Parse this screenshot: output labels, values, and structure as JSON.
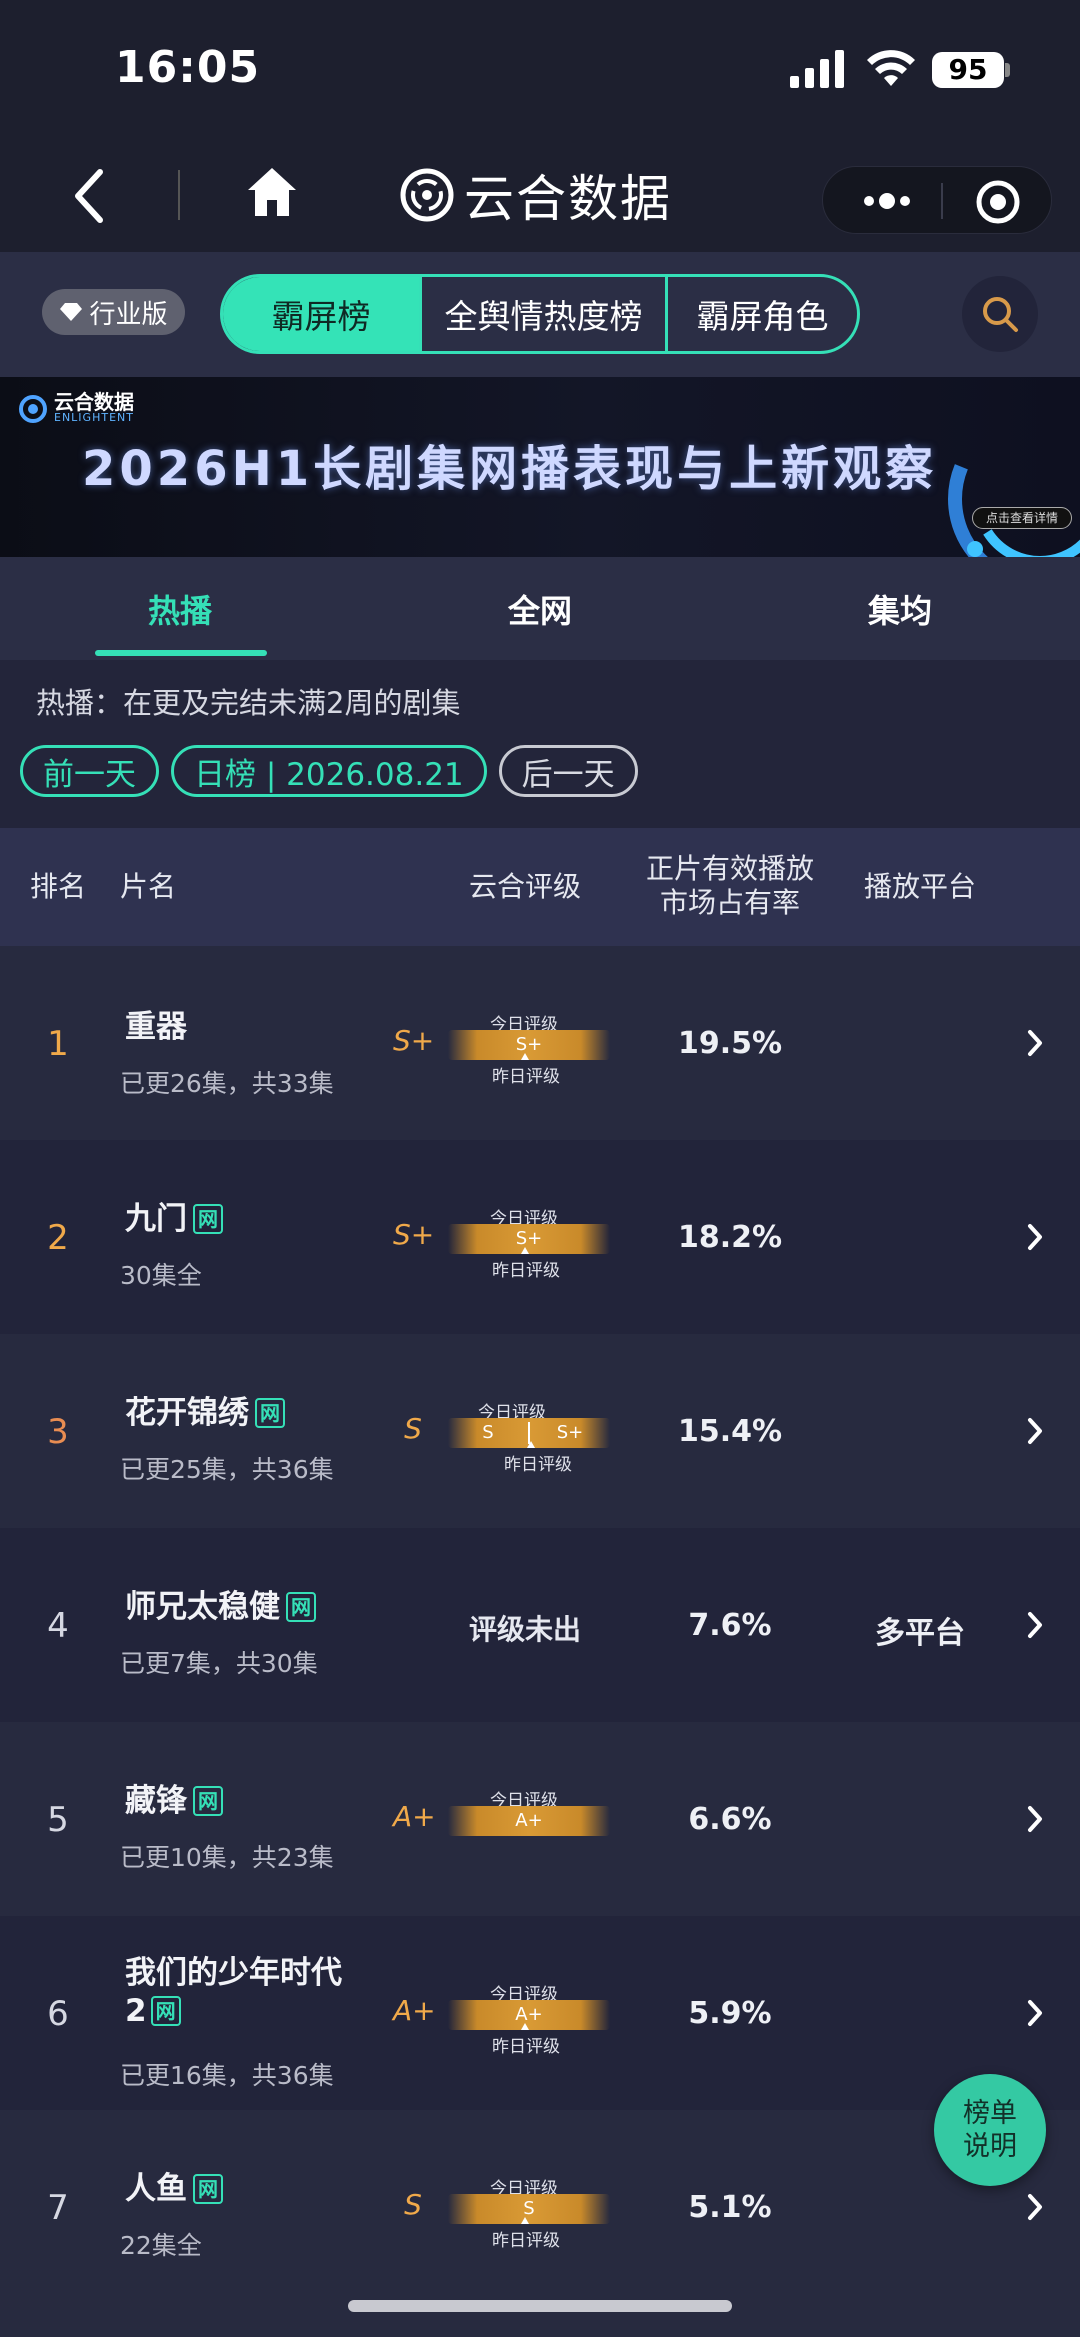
{
  "status": {
    "time": "16:05",
    "battery": "95"
  },
  "nav": {
    "title": "云合数据"
  },
  "toolbar": {
    "edition": "行业版",
    "tabs": [
      "霸屏榜",
      "全舆情热度榜",
      "霸屏角色"
    ]
  },
  "banner": {
    "brand_cn": "云合数据",
    "brand_en": "ENLIGHTENT",
    "title": "2026H1长剧集网播表现与上新观察",
    "cta": "点击查看详情"
  },
  "subtabs": [
    "热播",
    "全网",
    "集均"
  ],
  "description": "热播：在更及完结未满2周的剧集",
  "datebar": {
    "prev": "前一天",
    "current": "日榜 | 2026.08.21",
    "next": "后一天"
  },
  "table": {
    "headers": {
      "rank": "排名",
      "title": "片名",
      "grade": "云合评级",
      "share_line1": "正片有效播放",
      "share_line2": "市场占有率",
      "platform": "播放平台"
    },
    "grade_today_label": "今日评级",
    "grade_yesterday_label": "昨日评级",
    "rows": [
      {
        "rank": "1",
        "title": "重器",
        "title_line2": "",
        "web": false,
        "episodes": "已更26集，共33集",
        "grade": "S+",
        "bar": "S+",
        "bar_prev": "",
        "share": "19.5%",
        "platform": "",
        "no_grade": ""
      },
      {
        "rank": "2",
        "title": "九门",
        "title_line2": "",
        "web": true,
        "episodes": "30集全",
        "grade": "S+",
        "bar": "S+",
        "bar_prev": "",
        "share": "18.2%",
        "platform": "",
        "no_grade": ""
      },
      {
        "rank": "3",
        "title": "花开锦绣",
        "title_line2": "",
        "web": true,
        "episodes": "已更25集，共36集",
        "grade": "S",
        "bar": "S+",
        "bar_prev": "S",
        "share": "15.4%",
        "platform": "",
        "no_grade": ""
      },
      {
        "rank": "4",
        "title": "师兄太稳健",
        "title_line2": "",
        "web": true,
        "episodes": "已更7集，共30集",
        "grade": "",
        "bar": "",
        "bar_prev": "",
        "share": "7.6%",
        "platform": "多平台",
        "no_grade": "评级未出"
      },
      {
        "rank": "5",
        "title": "藏锋",
        "title_line2": "",
        "web": true,
        "episodes": "已更10集，共23集",
        "grade": "A+",
        "bar": "A+",
        "bar_prev": "",
        "share": "6.6%",
        "platform": "",
        "no_grade": ""
      },
      {
        "rank": "6",
        "title": "我们的少年时代",
        "title_line2": "2",
        "web": true,
        "episodes": "已更16集，共36集",
        "grade": "A+",
        "bar": "A+",
        "bar_prev": "",
        "share": "5.9%",
        "platform": "",
        "no_grade": ""
      },
      {
        "rank": "7",
        "title": "人鱼",
        "title_line2": "",
        "web": true,
        "episodes": "22集全",
        "grade": "S",
        "bar": "S",
        "bar_prev": "",
        "share": "5.1%",
        "platform": "",
        "no_grade": ""
      }
    ],
    "web_badge": "网"
  },
  "float_button": {
    "line1": "榜单",
    "line2": "说明"
  },
  "colors": {
    "accent": "#35e0b7",
    "gold": "#f0a94a",
    "bg": "#23253a"
  }
}
